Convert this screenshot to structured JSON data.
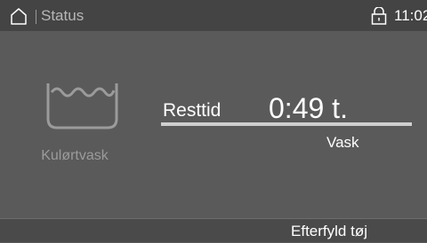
{
  "status_bar": {
    "title": "Status",
    "time": "11:02",
    "icons": {
      "home": "home-icon",
      "lock": "lock-icon"
    }
  },
  "program": {
    "name": "Kulørtvask",
    "icon": "wash-tub-icon"
  },
  "remaining": {
    "label": "Resttid",
    "value": "0:49 t.",
    "progress_fraction": 1.0
  },
  "phase": "Vask",
  "bottom_bar": {
    "refill_label": "Efterfyld tøj"
  },
  "colors": {
    "background": "#5a5a5a",
    "status_bar": "#444444",
    "muted_text": "#9b9b9b"
  }
}
